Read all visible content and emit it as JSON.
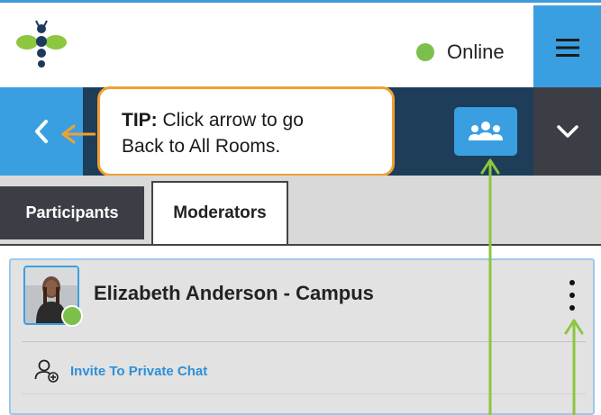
{
  "header": {
    "status_text": "Online",
    "status_color": "#7cc04b",
    "menu_icon": "hamburger-menu-icon",
    "logo_icon": "bee-logo-icon"
  },
  "room_bar": {
    "back_icon": "chevron-left-icon",
    "people_icon": "group-people-icon",
    "dropdown_icon": "chevron-down-icon"
  },
  "tip": {
    "label": "TIP:",
    "text_line1": " Click arrow to go",
    "text_line2": "Back to All Rooms."
  },
  "tabs": [
    {
      "label": "Participants",
      "active": false
    },
    {
      "label": "Moderators",
      "active": true
    }
  ],
  "participant": {
    "name": "Elizabeth Anderson - Campus",
    "online": true,
    "more_icon": "kebab-menu-icon",
    "action_label": "Invite To Private Chat",
    "action_icon": "add-person-icon"
  },
  "colors": {
    "accent_blue": "#3a9fe0",
    "navy": "#1e3d59",
    "dark_gray": "#3b3f45",
    "tip_border": "#f0a030",
    "annotation_green": "#8dc63f"
  }
}
